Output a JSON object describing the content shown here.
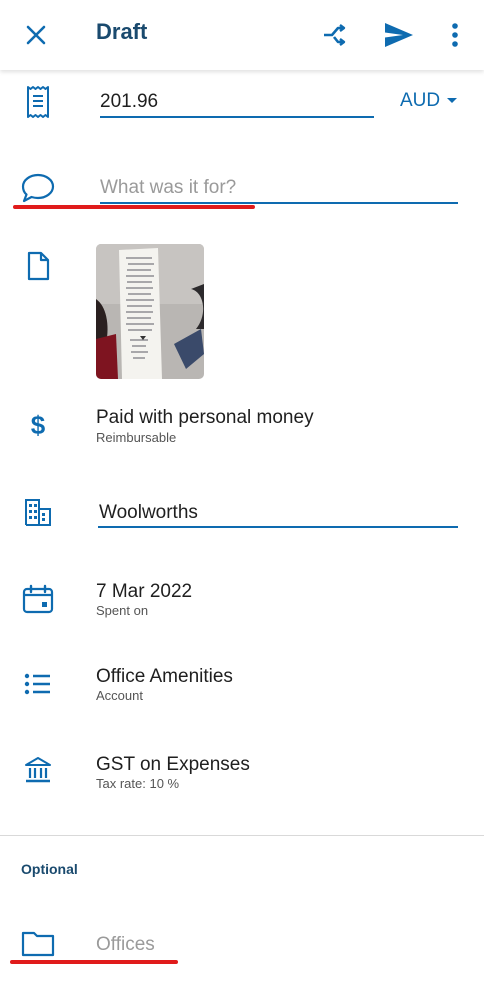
{
  "colors": {
    "accent": "#0e6bb0",
    "title": "#1a4a6e",
    "annotation": "#e01b1b"
  },
  "header": {
    "title": "Draft",
    "icons": {
      "close": "close-icon",
      "split": "shuffle-icon",
      "send": "send-icon",
      "menu": "more-vert-icon"
    }
  },
  "amount": {
    "value": "201.96",
    "currency": "AUD",
    "icon": "receipt-icon"
  },
  "description": {
    "placeholder": "What was it for?",
    "icon": "comment-icon"
  },
  "attachment": {
    "icon": "document-icon",
    "thumbnail": "receipt-photo"
  },
  "payment": {
    "label": "Paid with personal money",
    "sub": "Reimbursable",
    "icon": "dollar-icon"
  },
  "merchant": {
    "value": "Woolworths",
    "icon": "building-icon"
  },
  "date": {
    "value": "7 Mar 2022",
    "sub": "Spent on",
    "icon": "calendar-icon"
  },
  "account": {
    "value": "Office Amenities",
    "sub": "Account",
    "icon": "list-icon"
  },
  "tax": {
    "value": "GST on Expenses",
    "sub": "Tax rate: 10 %",
    "icon": "bank-icon"
  },
  "optional": {
    "heading": "Optional"
  },
  "project": {
    "placeholder": "Offices",
    "icon": "folder-icon"
  }
}
